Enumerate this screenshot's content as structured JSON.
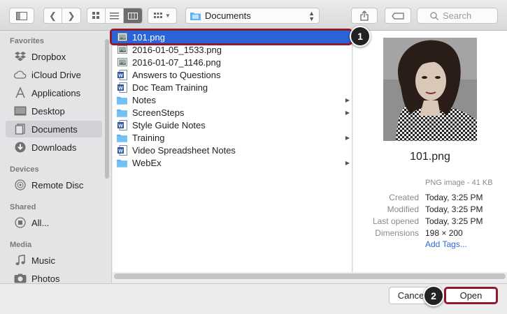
{
  "toolbar": {
    "location": "Documents",
    "search_placeholder": "Search"
  },
  "sidebar": {
    "sections": [
      {
        "title": "Favorites",
        "items": [
          {
            "label": "Dropbox",
            "icon": "dropbox-icon"
          },
          {
            "label": "iCloud Drive",
            "icon": "cloud-icon"
          },
          {
            "label": "Applications",
            "icon": "applications-icon"
          },
          {
            "label": "Desktop",
            "icon": "desktop-icon"
          },
          {
            "label": "Documents",
            "icon": "documents-icon",
            "selected": true
          },
          {
            "label": "Downloads",
            "icon": "downloads-icon"
          }
        ]
      },
      {
        "title": "Devices",
        "items": [
          {
            "label": "Remote Disc",
            "icon": "disc-icon"
          }
        ]
      },
      {
        "title": "Shared",
        "items": [
          {
            "label": "All...",
            "icon": "network-icon"
          }
        ]
      },
      {
        "title": "Media",
        "items": [
          {
            "label": "Music",
            "icon": "music-icon"
          },
          {
            "label": "Photos",
            "icon": "photos-icon"
          }
        ]
      }
    ]
  },
  "files": [
    {
      "name": "101.png",
      "type": "image",
      "selected": true
    },
    {
      "name": "2016-01-05_1533.png",
      "type": "image"
    },
    {
      "name": "2016-01-07_1146.png",
      "type": "image"
    },
    {
      "name": "Answers to Questions",
      "type": "word"
    },
    {
      "name": "Doc Team Training",
      "type": "word"
    },
    {
      "name": "Notes",
      "type": "folder"
    },
    {
      "name": "ScreenSteps",
      "type": "folder"
    },
    {
      "name": "Style Guide Notes",
      "type": "word"
    },
    {
      "name": "Training",
      "type": "folder"
    },
    {
      "name": "Video Spreadsheet Notes",
      "type": "word"
    },
    {
      "name": "WebEx",
      "type": "folder"
    }
  ],
  "preview": {
    "title": "101.png",
    "kind": "PNG image - 41 KB",
    "fields": [
      {
        "key": "Created",
        "value": "Today, 3:25 PM"
      },
      {
        "key": "Modified",
        "value": "Today, 3:25 PM"
      },
      {
        "key": "Last opened",
        "value": "Today, 3:25 PM"
      },
      {
        "key": "Dimensions",
        "value": "198 × 200"
      }
    ],
    "add_tags": "Add Tags..."
  },
  "buttons": {
    "cancel": "Cancel",
    "open": "Open"
  },
  "callouts": [
    "1",
    "2"
  ],
  "colors": {
    "selection": "#2a64d8",
    "highlight": "#8e1b2d",
    "link": "#2d6ad6",
    "folder": "#5fb5f1",
    "word": "#2b579a"
  }
}
